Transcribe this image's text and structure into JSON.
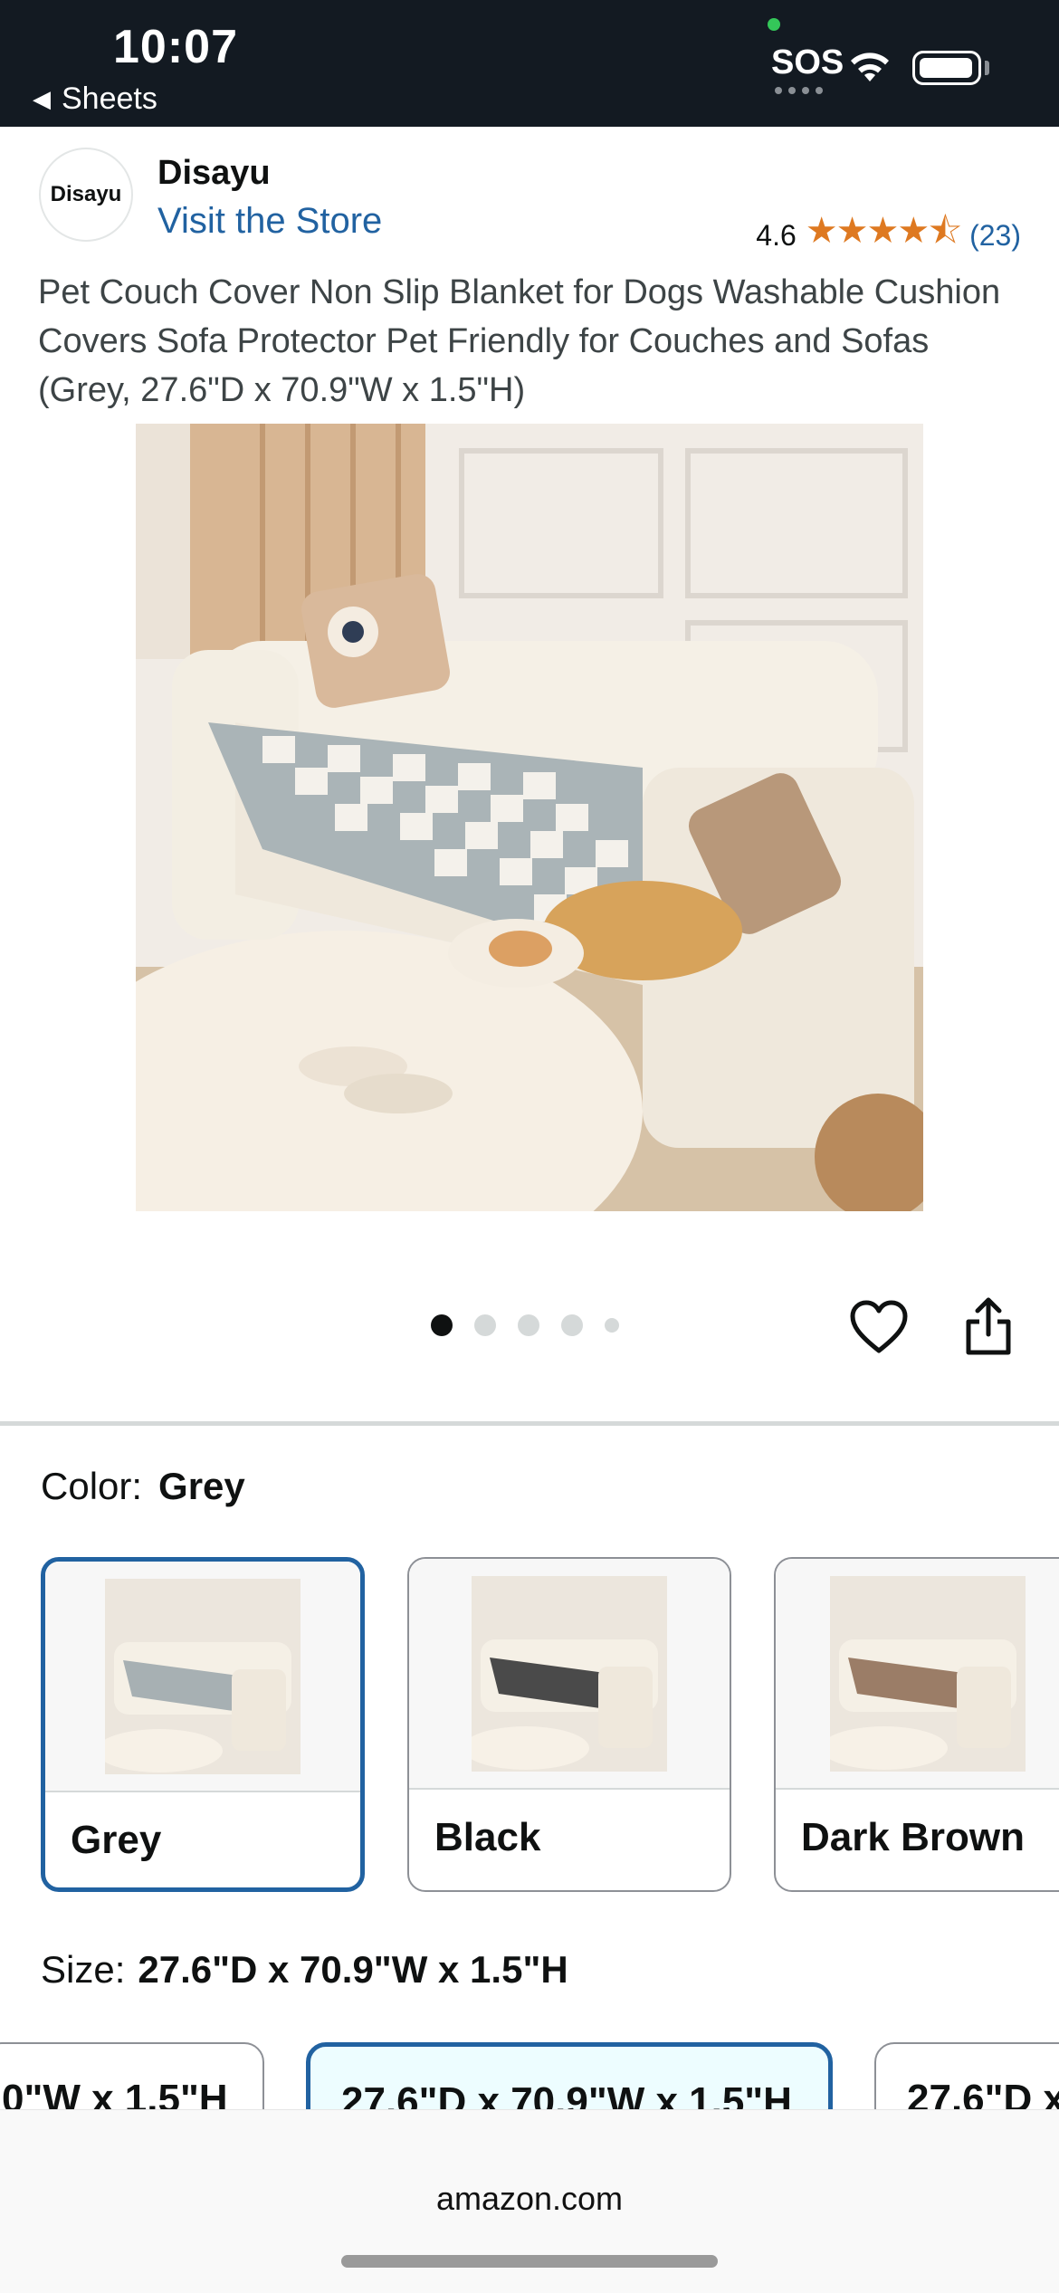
{
  "status_bar": {
    "time": "10:07",
    "back_label": "Sheets",
    "sos": "SOS",
    "icons": [
      "wifi-icon",
      "battery-icon"
    ]
  },
  "store": {
    "logo_text": "Disayu",
    "name": "Disayu",
    "link": "Visit the Store",
    "rating": "4.6",
    "stars": "★★★★⯪",
    "review_count": "(23)"
  },
  "product": {
    "title": "Pet Couch Cover Non Slip Blanket for Dogs Washable Cushion Covers Sofa Protector Pet Friendly for Couches and Sofas (Grey, 27.6\"D x 70.9\"W x 1.5\"H)",
    "image_count": 5,
    "active_image": 1
  },
  "color": {
    "label": "Color:",
    "selected": "Grey",
    "options": [
      "Grey",
      "Black",
      "Dark Brown"
    ]
  },
  "size": {
    "label": "Size:",
    "selected": "27.6\"D x 70.9\"W x 1.5\"H",
    "options": [
      "0\"W x 1.5\"H",
      "27.6\"D x 70.9\"W x 1.5\"H",
      "27.6\"D x"
    ]
  },
  "browser": {
    "url": "amazon.com"
  },
  "colors": {
    "status_bar": "#131a22",
    "link": "#2162a1",
    "star": "#de7921",
    "selected_border": "#2162a1"
  }
}
